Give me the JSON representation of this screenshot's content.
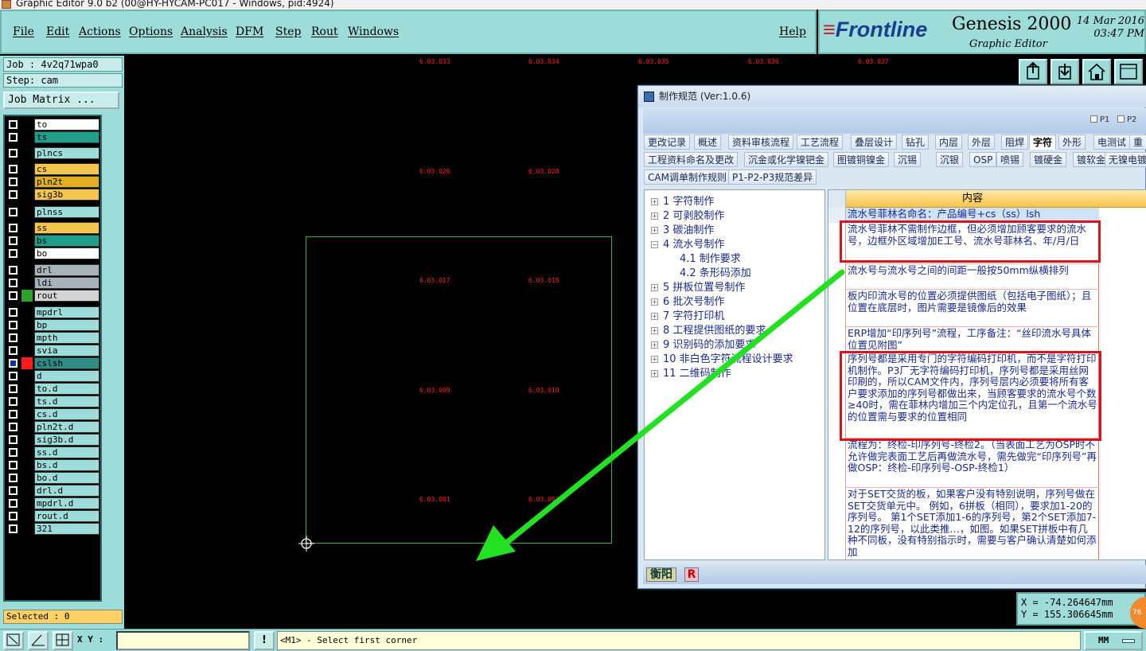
{
  "window": {
    "title": "Graphic Editor 9.0 b2 (00@HY-HYCAM-PC017 - Windows, pid:4924)"
  },
  "menu": {
    "file": "File",
    "edit": "Edit",
    "actions": "Actions",
    "options": "Options",
    "analysis": "Analysis",
    "dfm": "DFM",
    "step": "Step",
    "rout": "Rout",
    "windows": "Windows",
    "help": "Help"
  },
  "brand": {
    "frontline": "Frontline",
    "genesis": "Genesis 2000",
    "editor": "Graphic Editor",
    "date": "14 Mar 2016",
    "time": "03:47 PM",
    "colors": {
      "panel": "#9ddcd9",
      "logo_blue": "#1b3d8f",
      "logo_red": "#c0202a"
    }
  },
  "job": {
    "job_line": "Job : 4v2q71wpa0",
    "step_line": "Step: cam",
    "job_matrix": "Job Matrix ..."
  },
  "layers": [
    {
      "name": "to",
      "color": "#ffffff"
    },
    {
      "name": "ts",
      "color": "#1f9e8a"
    },
    {
      "name": "plncs",
      "color": "#9ddcd9"
    },
    {
      "name": "cs",
      "color": "#f5c64d"
    },
    {
      "name": "pln2t",
      "color": "#e0b020"
    },
    {
      "name": "sig3b",
      "color": "#f5c64d"
    },
    {
      "name": "plnss",
      "color": "#9ddcd9"
    },
    {
      "name": "ss",
      "color": "#f5c64d"
    },
    {
      "name": "bs",
      "color": "#1f9e8a"
    },
    {
      "name": "bo",
      "color": "#ffffff"
    },
    {
      "name": "drl",
      "color": "#a9b4ba"
    },
    {
      "name": "ldi",
      "color": "#a9b4ba"
    },
    {
      "name": "rout",
      "color": "#d4d4d4"
    },
    {
      "name": "mpdrl",
      "color": "#9ddcd9"
    },
    {
      "name": "bp",
      "color": "#9ddcd9"
    },
    {
      "name": "mpth",
      "color": "#9ddcd9"
    },
    {
      "name": "svia",
      "color": "#9ddcd9"
    },
    {
      "name": "cslsh",
      "color": "#2e8c84"
    },
    {
      "name": "d",
      "color": "#9ddcd9"
    },
    {
      "name": "to.d",
      "color": "#9ddcd9"
    },
    {
      "name": "ts.d",
      "color": "#9ddcd9"
    },
    {
      "name": "cs.d",
      "color": "#9ddcd9"
    },
    {
      "name": "pln2t.d",
      "color": "#9ddcd9"
    },
    {
      "name": "sig3b.d",
      "color": "#9ddcd9"
    },
    {
      "name": "ss.d",
      "color": "#9ddcd9"
    },
    {
      "name": "bs.d",
      "color": "#9ddcd9"
    },
    {
      "name": "bo.d",
      "color": "#9ddcd9"
    },
    {
      "name": "drl.d",
      "color": "#9ddcd9"
    },
    {
      "name": "mpdrl.d",
      "color": "#9ddcd9"
    },
    {
      "name": "rout.d",
      "color": "#9ddcd9"
    },
    {
      "name": "321",
      "color": "#9ddcd9"
    }
  ],
  "selected": "Selected : 0",
  "canvas_labels": {
    "r1": [
      "6.03.033",
      "6.03.034",
      "6.03.035",
      "6.03.036",
      "6.03.037"
    ],
    "r2": [
      "6.03.026",
      "6.03.028"
    ],
    "r3": [
      "6.03.017",
      "6.03.018"
    ],
    "r4": [
      "6.03.009",
      "6.03.010"
    ],
    "r5": [
      "6.03.001",
      "6.03.002"
    ]
  },
  "dialog": {
    "title": "制作规范 (Ver:1.0.6)",
    "p1": "P1",
    "p2": "P2",
    "tabs_row1": [
      "更改记录",
      "概述",
      "资料审核流程",
      "工艺流程",
      "叠层设计",
      "钻孔",
      "内层",
      "外层",
      "阻焊",
      "字符",
      "外形",
      "电测试",
      "重"
    ],
    "active_tab": "字符",
    "tabs_row2": [
      "工程资料命名及更改",
      "沉金或化学镍钯金",
      "图镀铜镍金",
      "沉锡",
      "沉银",
      "OSP",
      "喷锡",
      "镀硬金",
      "镀软金",
      "无镍电镀"
    ],
    "tabs_row3": [
      "CAM调单制作规则",
      "P1-P2-P3规范差异"
    ],
    "tree": [
      "1 字符制作",
      "2 可剥胶制作",
      "3 碳油制作",
      "4 流水号制作",
      "4.1 制作要求",
      "4.2 条形码添加",
      "5 拼板位置号制作",
      "6 批次号制作",
      "7 字符打印机",
      "8 工程提供图纸的要求",
      "9 识别码的添加要求",
      "10 非白色字符流程设计要求",
      "11 二维码制作"
    ],
    "grid_header": "内容",
    "rows": [
      "流水号菲林名命名：产品编号+cs（ss）lsh",
      "流水号菲林不需制作边框，但必须增加顾客要求的流水号，边框外区域增加E工号、流水号菲林名、年/月/日",
      "流水号与流水号之间的间距一般按50mm纵横排列",
      "板内印流水号的位置必须提供图纸（包括电子图纸）；且位置在底层时，图片需要是镜像后的效果",
      "ERP增加“印序列号”流程，工序备注：“丝印流水号具体位置见附图”",
      "序列号都是采用专门的字符编码打印机，而不是字符打印机制作。P3厂无字符编码打印机，序列号都是采用丝网印刷的，所以CAM文件内，序列号层内必须要将所有客户要求添加的序列号都做出来，当顾客要求的流水号个数≥40时，需在菲林内增加三个内定位孔，且第一个流水号的位置需与要求的位置相同",
      "流程为：终检-印序列号-终检2。（当表面工艺为OSP时不允许做完表面工艺后再做流水号，需先做完“印序列号”再做OSP：终检-印序列号-OSP-终检1）",
      "对于SET交货的板，如果客户没有特别说明，序列号做在SET交货单元中。 例如，6拼板（相同），要求加1-20的序列号。 第1个SET添加1-6的序列号，第2个SET添加7-12的序列号，以此类推…，如图。如果SET拼板中有几种不同板，没有特别指示时，需要与客户确认清楚如何添加"
    ],
    "status_user": "衡阳",
    "status_r": "R"
  },
  "readout": {
    "x": "X = -74.264647mm",
    "y": "Y = 155.306645mm",
    "badge": "76"
  },
  "bottom": {
    "xy_label": "X Y :",
    "prompt": "<M1> - Select first corner",
    "units": "MM"
  }
}
